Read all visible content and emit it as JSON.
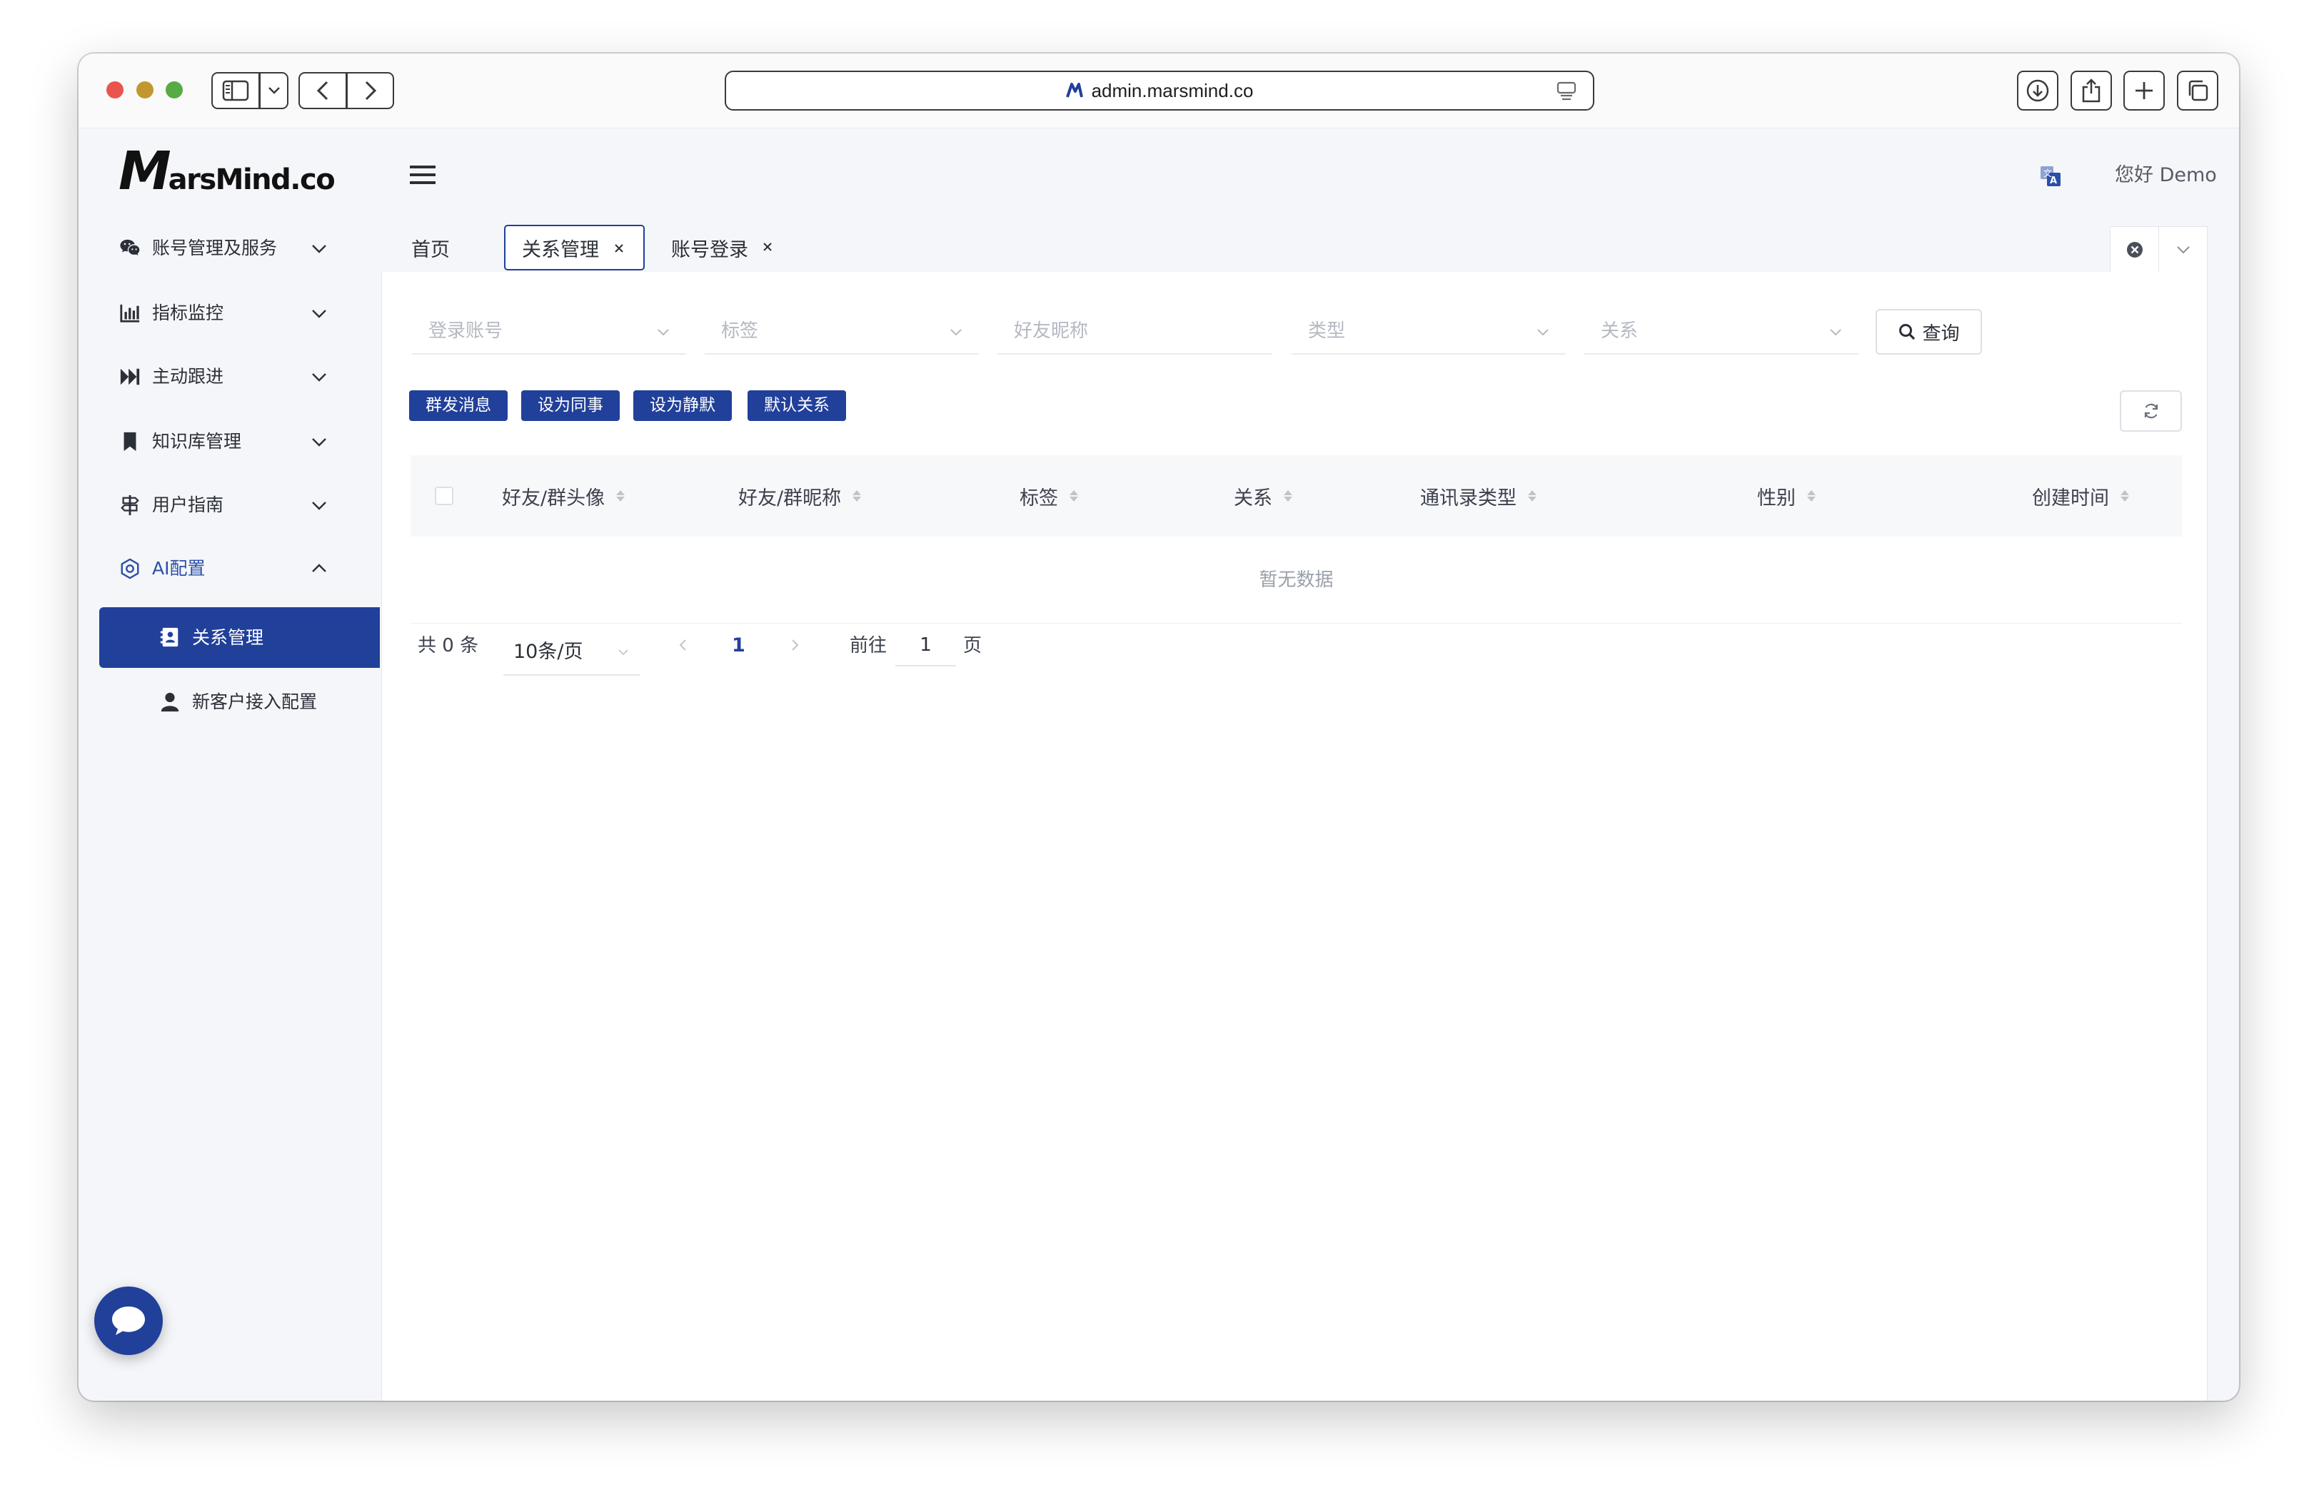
{
  "browser": {
    "url": "admin.marsmind.co",
    "icons": {
      "sidebar_toggle": "sidebar-icon",
      "back": "chevron-left-icon",
      "forward": "chevron-right-icon",
      "reader": "reader-icon",
      "download": "download-icon",
      "share": "share-icon",
      "new_tab": "plus-icon",
      "tab_overview": "tabs-icon"
    }
  },
  "app": {
    "logo": {
      "mark": "M",
      "text": "arsMind.co"
    },
    "greeting": "您好 Demo",
    "menu_icon": "hamburger-icon",
    "language_icon": "translate-icon",
    "chat_icon": "chat-bubble-icon"
  },
  "sidebar": {
    "items": [
      {
        "label": "账号管理及服务",
        "icon": "wechat-icon",
        "expanded": false
      },
      {
        "label": "指标监控",
        "icon": "bar-chart-icon",
        "expanded": false
      },
      {
        "label": "主动跟进",
        "icon": "fast-forward-icon",
        "expanded": false
      },
      {
        "label": "知识库管理",
        "icon": "bookmark-icon",
        "expanded": false
      },
      {
        "label": "用户指南",
        "icon": "signpost-icon",
        "expanded": false
      },
      {
        "label": "AI配置",
        "icon": "gear-icon",
        "expanded": true
      }
    ],
    "sub_items": [
      {
        "label": "关系管理",
        "icon": "contact-card-icon",
        "active": true
      },
      {
        "label": "新客户接入配置",
        "icon": "user-icon",
        "active": false
      }
    ]
  },
  "tabs": {
    "items": [
      {
        "label": "首页",
        "closable": false,
        "active": false
      },
      {
        "label": "关系管理",
        "closable": true,
        "active": true
      },
      {
        "label": "账号登录",
        "closable": true,
        "active": false
      }
    ]
  },
  "filters": {
    "login_account": {
      "placeholder": "登录账号"
    },
    "tag": {
      "placeholder": "标签"
    },
    "friend_nickname": {
      "placeholder": "好友昵称"
    },
    "contact_type": {
      "placeholder": "类型"
    },
    "relation": {
      "placeholder": "关系"
    },
    "search_label": "查询"
  },
  "actions": [
    "群发消息",
    "设为同事",
    "设为静默",
    "默认关系"
  ],
  "table": {
    "columns": [
      "好友/群头像",
      "好友/群昵称",
      "标签",
      "关系",
      "通讯录类型",
      "性别",
      "创建时间"
    ],
    "rows": [],
    "empty_text": "暂无数据"
  },
  "pagination": {
    "total": "共 0 条",
    "page_size": "10条/页",
    "current_page": "1",
    "goto_label": "前往",
    "goto_value": "1",
    "page_suffix": "页"
  },
  "colors": {
    "primary": "#21409a",
    "accent_text": "#2c4fa8",
    "content_bg": "#f5f6f9",
    "panel_bg": "#ffffff",
    "table_header_bg": "#f7f8fa",
    "placeholder": "#b4b9c2"
  }
}
